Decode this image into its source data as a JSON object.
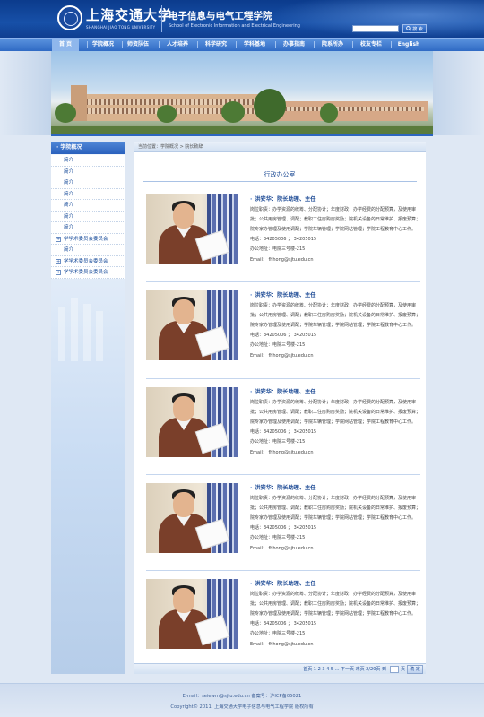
{
  "header": {
    "university_cn": "上海交通大学",
    "university_en": "SHANGHAI JIAO TONG UNIVERSITY",
    "school_cn": "电子信息与电气工程学院",
    "school_en": "School of Electronic Information and Electrical Engineering",
    "search_value": "",
    "search_button_label": "搜 索",
    "search_icon": "search-icon"
  },
  "nav": {
    "items": [
      {
        "label": "首 页",
        "active": true
      },
      {
        "label": "学院概况"
      },
      {
        "label": "师资队伍"
      },
      {
        "label": "人才培养"
      },
      {
        "label": "科学研究"
      },
      {
        "label": "学科基地"
      },
      {
        "label": "办事指南"
      },
      {
        "label": "院系所办"
      },
      {
        "label": "校友专栏"
      },
      {
        "label": "English"
      }
    ]
  },
  "sidebar": {
    "title": "学院概况",
    "items": [
      {
        "label": "简介"
      },
      {
        "label": "简介"
      },
      {
        "label": "简介"
      },
      {
        "label": "简介"
      },
      {
        "label": "简介"
      },
      {
        "label": "简介"
      },
      {
        "label": "简介"
      },
      {
        "label": "学学术委员会委员会",
        "expandable": true
      },
      {
        "label": "简介"
      },
      {
        "label": "学学术委员会委员会",
        "expandable": true
      },
      {
        "label": "学学术委员会委员会",
        "expandable": true
      }
    ]
  },
  "main": {
    "breadcrumb": "当前位置：学院概况 > 院长致辞",
    "title": "行政办公室",
    "people": [
      {
        "name": "洪安华：院长助理、主任",
        "duty": "岗位职责：办学资源的统筹、分配协计；年度财政：办学经费的分配预算，及使用审批；公共用房管理、调配；教职工住房购房奖励；院机关设备的日常维护、报废预算；院专家办管理及使用调配；学院车辆管理；学院网站管理；学院工程教育中心工作。",
        "phone": "电话：34205006 ； 34205015",
        "office": "办公地址：电院三号楼-215",
        "email": "Email： fhhong@sjtu.edu.cn"
      },
      {
        "name": "洪安华：院长助理、主任",
        "duty": "岗位职责：办学资源的统筹、分配协计；年度财政：办学经费的分配预算，及使用审批；公共用房管理、调配；教职工住房购房奖励；院机关设备的日常维护、报废预算；院专家办管理及使用调配；学院车辆管理；学院网站管理；学院工程教育中心工作。",
        "phone": "电话：34205006 ； 34205015",
        "office": "办公地址：电院三号楼-215",
        "email": "Email： fhhong@sjtu.edu.cn"
      },
      {
        "name": "洪安华：院长助理、主任",
        "duty": "岗位职责：办学资源的统筹、分配协计；年度财政：办学经费的分配预算，及使用审批；公共用房管理、调配；教职工住房购房奖励；院机关设备的日常维护、报废预算；院专家办管理及使用调配；学院车辆管理；学院网站管理；学院工程教育中心工作。",
        "phone": "电话：34205006 ； 34205015",
        "office": "办公地址：电院三号楼-215",
        "email": "Email： fhhong@sjtu.edu.cn"
      },
      {
        "name": "洪安华：院长助理、主任",
        "duty": "岗位职责：办学资源的统筹、分配协计；年度财政：办学经费的分配预算，及使用审批；公共用房管理、调配；教职工住房购房奖励；院机关设备的日常维护、报废预算；院专家办管理及使用调配；学院车辆管理；学院网站管理；学院工程教育中心工作。",
        "phone": "电话：34205006 ； 34205015",
        "office": "办公地址：电院三号楼-215",
        "email": "Email： fhhong@sjtu.edu.cn"
      },
      {
        "name": "洪安华：院长助理、主任",
        "duty": "岗位职责：办学资源的统筹、分配协计；年度财政：办学经费的分配预算，及使用审批；公共用房管理、调配；教职工住房购房奖励；院机关设备的日常维护、报废预算；院专家办管理及使用调配；学院车辆管理；学院网站管理；学院工程教育中心工作。",
        "phone": "电话：34205006 ； 34205015",
        "office": "办公地址：电院三号楼-215",
        "email": "Email： fhhong@sjtu.edu.cn"
      }
    ],
    "pagination": {
      "text": "首页 1 2 3 4 5 ... 下一页 末页 2/20页 到",
      "input_value": "",
      "suffix": "页",
      "go_label": "确 定"
    }
  },
  "footer": {
    "line1": "E-mail：seiewm@sjtu.edu.cn 备案号：沪ICP备05021",
    "line2": "Copyright© 2011, 上海交通大学电子信息与电气工程学院 版权所有"
  },
  "colors": {
    "brand_dark": "#0b3b8c",
    "nav_blue": "#2f6ac4",
    "link_blue": "#1f4c96",
    "page_bg": "#dfe8f4"
  }
}
